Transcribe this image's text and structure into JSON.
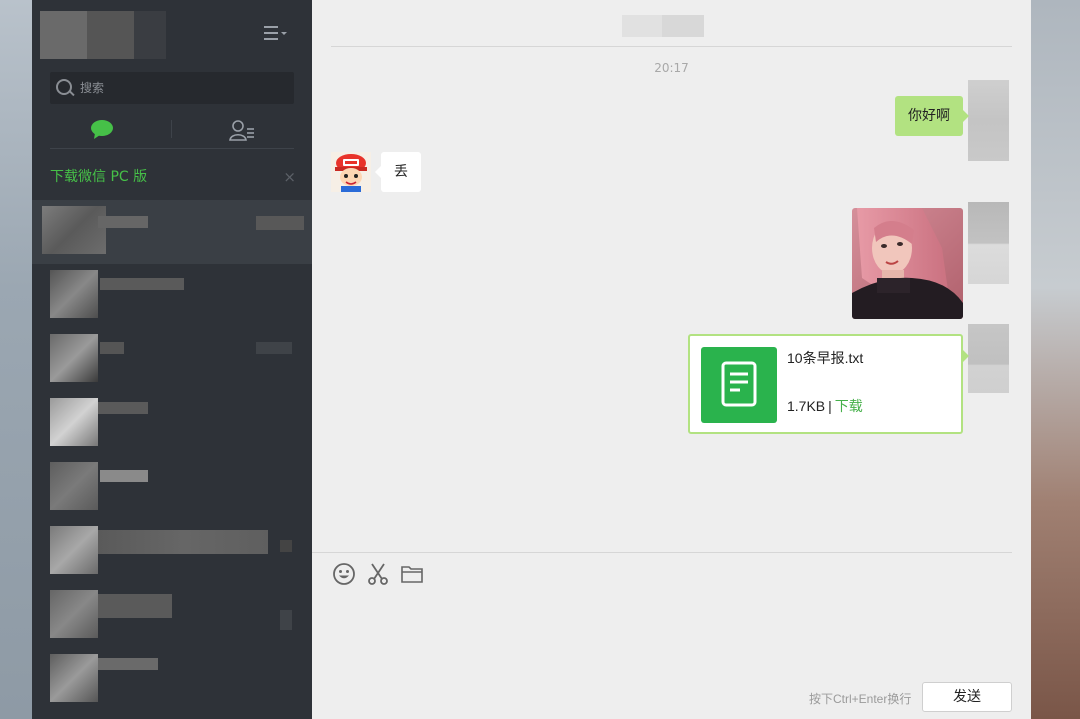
{
  "sidebar": {
    "search": {
      "placeholder": "搜索"
    },
    "tabs": [
      {
        "name": "chat-icon",
        "active": true,
        "color": "#46c048"
      },
      {
        "name": "contacts-icon",
        "active": false,
        "color": "#9aa0a8"
      }
    ],
    "download_banner": {
      "label": "下载微信 PC 版",
      "close": "×"
    },
    "active_chat_index": 0
  },
  "conversation": {
    "timestamp": "20:17",
    "messages": [
      {
        "side": "right",
        "type": "text",
        "text": "你好啊"
      },
      {
        "side": "left",
        "type": "text",
        "text": "丢"
      },
      {
        "side": "right",
        "type": "image"
      },
      {
        "side": "right",
        "type": "file",
        "file_name": "10条早报.txt",
        "file_size": "1.7KB",
        "separator": "|",
        "action": "下载"
      }
    ]
  },
  "editor": {
    "tools": [
      "emoji-icon",
      "scissors-icon",
      "folder-icon"
    ],
    "hint": "按下Ctrl+Enter换行",
    "send_label": "发送"
  },
  "colors": {
    "sidebar_bg": "#2e3238",
    "accent_green": "#46c048",
    "bubble_green": "#b2e281",
    "file_icon_green": "#2ab34d",
    "main_bg": "#eeeeee"
  }
}
